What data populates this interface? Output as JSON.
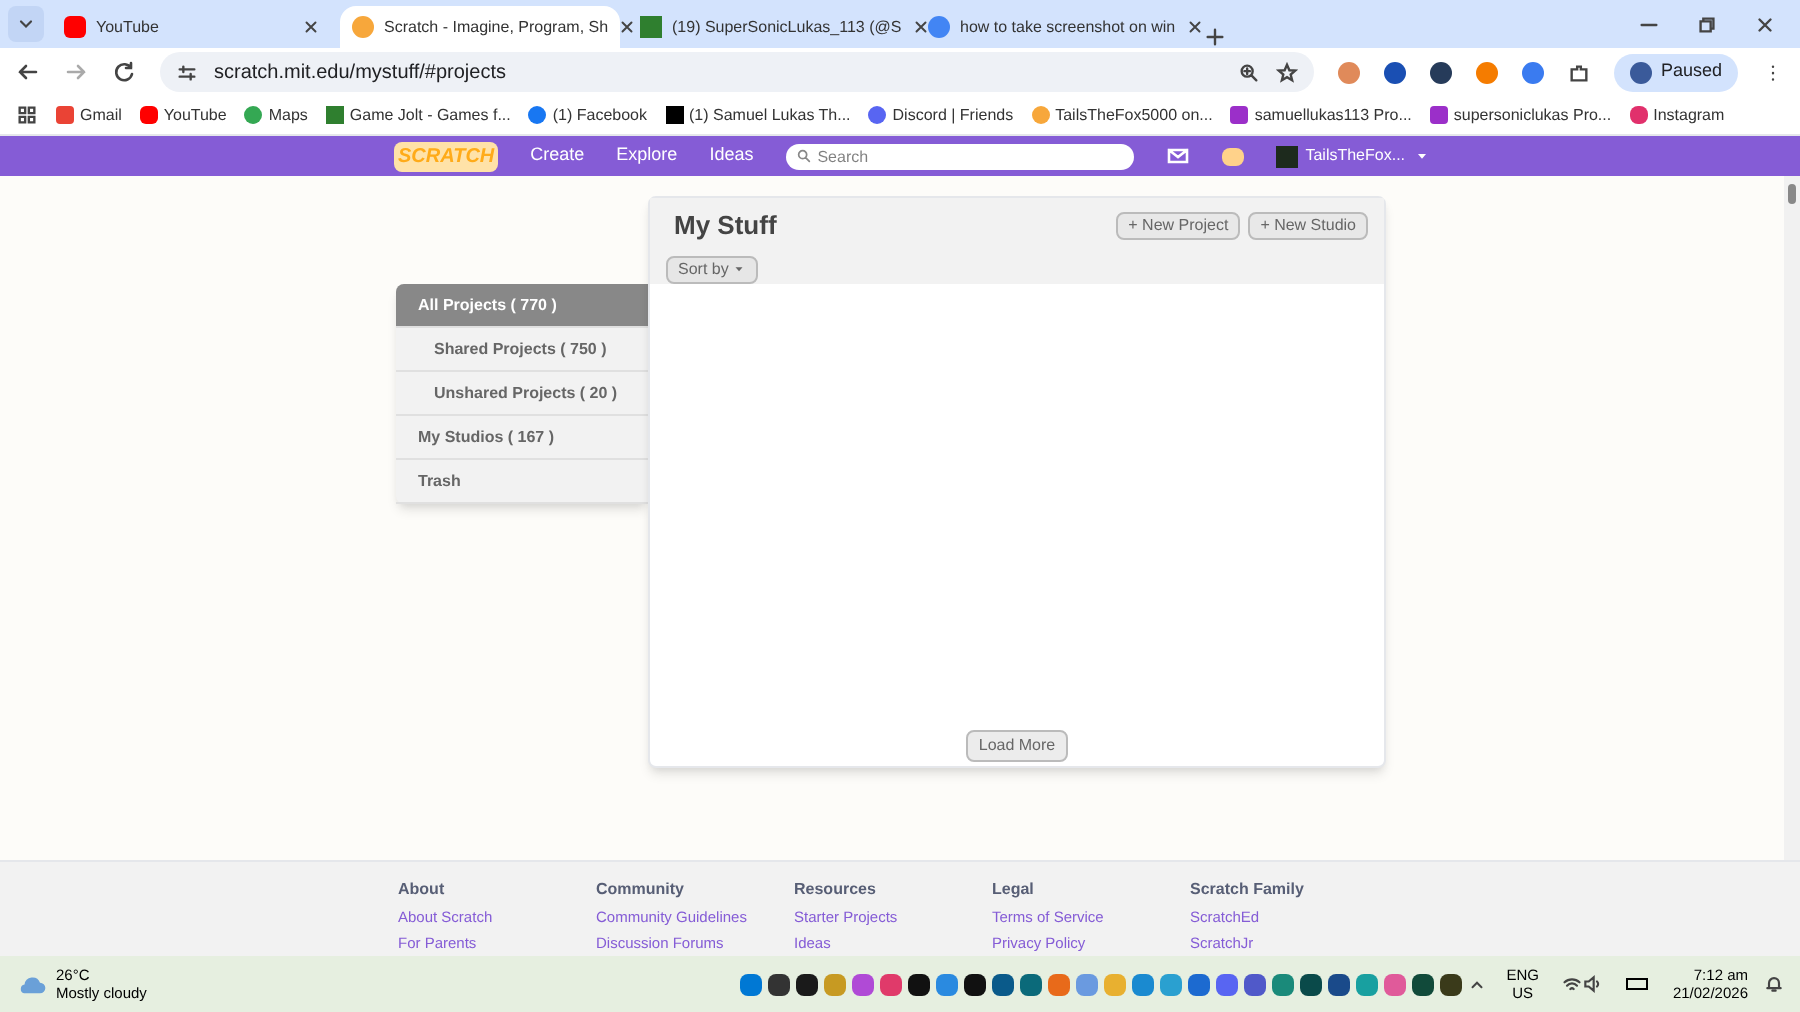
{
  "browser": {
    "tabs": [
      {
        "title": "YouTube",
        "selected": false
      },
      {
        "title": "Scratch - Imagine, Program, Sh",
        "selected": true
      },
      {
        "title": "(19) SuperSonicLukas_113 (@S",
        "selected": false
      },
      {
        "title": "how to take screenshot on win",
        "selected": false
      }
    ],
    "url": "scratch.mit.edu/mystuff/#projects",
    "profile": "Paused",
    "bookmarks": [
      {
        "label": "Gmail"
      },
      {
        "label": "YouTube"
      },
      {
        "label": "Maps"
      },
      {
        "label": "Game Jolt - Games f..."
      },
      {
        "label": "(1) Facebook"
      },
      {
        "label": "(1) Samuel Lukas Th..."
      },
      {
        "label": "Discord | Friends"
      },
      {
        "label": "TailsTheFox5000 on..."
      },
      {
        "label": "samuellukas113 Pro..."
      },
      {
        "label": "supersoniclukas Pro..."
      },
      {
        "label": "Instagram"
      }
    ]
  },
  "site_nav": {
    "logo": "SCRATCH",
    "links": [
      "Create",
      "Explore",
      "Ideas"
    ],
    "search": {
      "placeholder": "Search"
    },
    "username": "TailsTheFox..."
  },
  "my_stuff": {
    "title": "My Stuff",
    "buttons": [
      "+ New Project",
      "+ New Studio"
    ],
    "sort": "Sort by",
    "load_more": "Load More",
    "sidebar": [
      {
        "label": "All Projects ( 770 )",
        "selected": true,
        "children": [
          {
            "label": "Shared Projects ( 750 )",
            "selected": false
          },
          {
            "label": "Unshared Projects ( 20 )",
            "selected": false
          }
        ]
      },
      {
        "label": "My Studios ( 167 )",
        "selected": false
      },
      {
        "label": "Trash",
        "selected": false
      }
    ]
  },
  "footer": [
    {
      "heading": "About",
      "links": [
        "About Scratch",
        "For Parents"
      ]
    },
    {
      "heading": "Community",
      "links": [
        "Community Guidelines",
        "Discussion Forums"
      ]
    },
    {
      "heading": "Resources",
      "links": [
        "Starter Projects",
        "Ideas"
      ]
    },
    {
      "heading": "Legal",
      "links": [
        "Terms of Service",
        "Privacy Policy"
      ]
    },
    {
      "heading": "Scratch Family",
      "links": [
        "ScratchEd",
        "ScratchJr"
      ]
    }
  ],
  "taskbar": {
    "temperature": "26°C",
    "weather": "Mostly cloudy",
    "language": "ENG",
    "region": "US",
    "time": "7:12 am",
    "date": "21/02/2026"
  }
}
